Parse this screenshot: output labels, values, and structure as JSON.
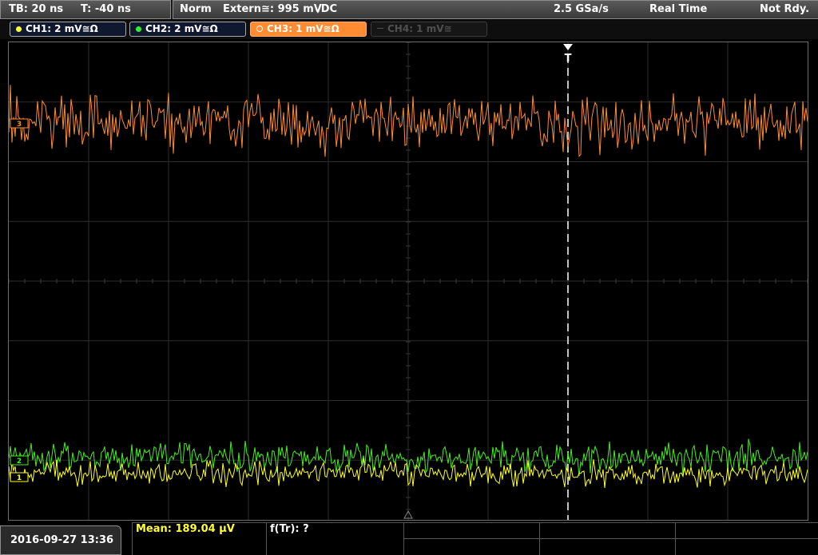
{
  "status": {
    "timebase": "TB: 20 ns",
    "trigger_offset": "T: -40 ns",
    "trigger_mode": "Norm",
    "trigger_source": "Extern≅: 995 mV",
    "trigger_slope": "∕DC",
    "sample_rate": "2.5 GSa/s",
    "acq_mode": "Real Time",
    "state": "Not Rdy."
  },
  "channels": [
    {
      "label": "CH1: 2 mV≅Ω",
      "color": "#ffff33",
      "active": true
    },
    {
      "label": "CH2: 2 mV≅Ω",
      "color": "#33ee33",
      "active": true
    },
    {
      "label": "CH3: 1 mV≅Ω",
      "color": "#ff8c33",
      "active": true,
      "selected": true
    },
    {
      "label": "CH4: 1 mV≅",
      "color": "#505050",
      "active": false
    }
  ],
  "markers": {
    "trigger": "T",
    "ch3_ground": "3",
    "ch2_ground": "2",
    "ch1_ground": "1"
  },
  "footer": {
    "datetime": "2016-09-27 13:36",
    "meas1": "Mean: 189.04 µV",
    "meas2": "f(Tr): ?"
  }
}
